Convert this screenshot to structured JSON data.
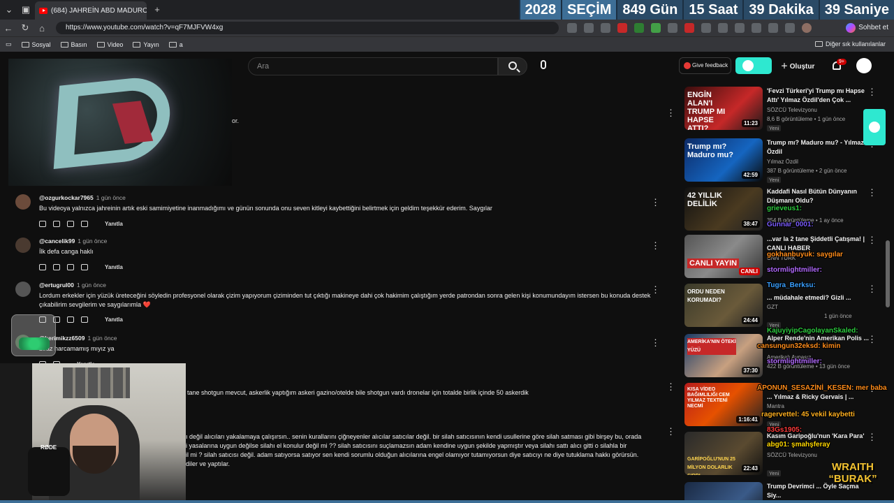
{
  "browser": {
    "tab_title": "(684) JAHREİN ABD MADURO OPE",
    "tab_close": "✕",
    "new_tab": "+",
    "url": "https://www.youtube.com/watch?v=qF7MJFVW4xg",
    "copilot_label": "Sohbet et",
    "bookmarks": [
      "Sosyal",
      "Basın",
      "Video",
      "Yayın",
      "a"
    ],
    "bookmarks_right": "Diğer sık kullanılanlar"
  },
  "countdown": {
    "year": "2028",
    "label": "SEÇİM",
    "days": "849 Gün",
    "hours": "15 Saat",
    "minutes": "39 Dakika",
    "seconds": "39 Saniye"
  },
  "youtube_header": {
    "search_placeholder": "Ara",
    "feedback_label": "Give feedback",
    "create_label": "Oluştur",
    "notif_count": "9+"
  },
  "video_stub_text": "or.",
  "comments": [
    {
      "user": "@ozgurkockar7965",
      "time": "1 gün önce",
      "text": "Bu videoya yalnızca jahreinin artık eski samimiyetine inanmadığımı ve günün sonunda onu seven kitleyi kaybettiğini belirtmek için geldim teşekkür ederim. Saygılar",
      "reply": "Yanıtla"
    },
    {
      "user": "@cancelik99",
      "time": "1 gün önce",
      "text": "İlk defa canga haklı",
      "reply": "Yanıtla"
    },
    {
      "user": "@ertugrul00",
      "time": "1 gün önce",
      "text": "Lordum erkekler için yüzük üreteceğini söyledin profesyonel olarak çizim yapıyorum çiziminden tut çıktığı makineye dahi çok hakimim çalıştığım yerde patrondan sonra gelen kişi konumundayım istersen bu konuda destek çıkabilirim sevgilerim ve saygılarımla ❤️",
      "reply": "Yanıtla"
    },
    {
      "user": "@kerimikzz6509",
      "time": "1 gün önce",
      "text": "biraz harcamamış mıyız ya",
      "reply": "Yanıtla"
    }
  ],
  "partial_lines": {
    "l1": "tane shotgun mevcut, askerlik yaptığım askeri gazino/otelde bile shotgun vardı dronelar için totalde birlik içinde 50 askerdik",
    "l2": "ı değil alıcıları yakalamaya çalışırsın.. senin kurallarını çiğneyenler alıcılar satıcılar değil. bir silah satıcısının kendi usullerine göre silah satması gibi birşey bu, orada",
    "l3": "i yasalarına uygun değilse silahı el konulur değil mi ?? silah satıcısını suçlamazsın adam kendine uygun şekilde yapmıştır veya silahı sattı alıcı gitti o silahla bir",
    "l4": "il mi ? silah satıcısı değil. adam satıyorsa satıyor sen kendi sorumlu olduğun alıcılarına engel olamıyor tutamıyorsun diye satıcıyı ne diye tutuklama hakkı görürsün.",
    "l5": "diler ve yaptılar."
  },
  "webcam_mic_label": "RØDE",
  "related": [
    {
      "thumb_text": "ENGİN ALAN'I TRUMP MI HAPSE ATTI?",
      "duration": "11:23",
      "title": "'Fevzi Türkeri'yi Trump mı Hapse Attı' Yılmaz Özdil'den Çok ...",
      "channel": "SÖZCÜ Televizyonu",
      "meta": "8,6 B görüntüleme • 1 gün önce",
      "new": "Yeni"
    },
    {
      "thumb_text": "Trump mı? Maduro mu?",
      "duration": "42:59",
      "title": "Trump mı? Maduro mu? - Yılmaz Özdil",
      "channel": "Yılmaz Özdil",
      "meta": "387 B görüntüleme • 2 gün önce",
      "new": "Yeni"
    },
    {
      "thumb_text": "42 YILLIK DELİLİK",
      "duration": "38:47",
      "title": "Kaddafi Nasıl Bütün Dünyanın Düşmanı Oldu?",
      "channel": "",
      "meta": "354 B görüntüleme • 1 ay önce",
      "new": ""
    },
    {
      "thumb_text": "CANLI YAYIN",
      "duration": "CANLI",
      "title": "...var la 2 tane Şiddetli Çatışma! | CANLI HABER",
      "channel": "CNN TÜRK",
      "meta": "",
      "new": ""
    },
    {
      "thumb_text": "ORDU NEDEN KORUMADI?",
      "duration": "24:44",
      "title": "... müdahale etmedi? Gizli ...",
      "channel": "GZT",
      "meta": "1 gün önce",
      "new": "Yeni"
    },
    {
      "thumb_text": "AMERİKA'NIN ÖTEKİ YÜZÜ",
      "duration": "37:30",
      "title": "Alper Rende'nin Amerikan Polis ...",
      "channel": "Amerikalı Avpaşız",
      "meta": "422 B görüntüleme • 13 gün önce",
      "new": ""
    },
    {
      "thumb_text": "KISA VİDEO BAĞIMLILIĞI CEM YILMAZ TEXTENİ NECMİ",
      "duration": "1:16:41",
      "title": "... Yılmaz & Ricky Gervais | ...",
      "channel": "Mantra",
      "meta": "",
      "new": "Yeni"
    },
    {
      "thumb_text": "GARİPOĞLU'NUN 25 MİLYON DOLARLIK SIRRI",
      "duration": "22:43",
      "title": "Kasım Garipoğlu'nun 'Kara Para' ...",
      "channel": "SÖZCÜ Televizyonu",
      "meta": "",
      "new": "Yeni"
    },
    {
      "thumb_text": "",
      "duration": "",
      "title": "Trump Devrimci ... Öyle Saçma Siy...",
      "channel": "",
      "meta": "",
      "new": ""
    }
  ],
  "chat_overlay": [
    {
      "text": "grieveus1:",
      "color": "#2ecc40"
    },
    {
      "text": "Gunnar_0001:",
      "color": "#7b5cff"
    },
    {
      "text": "gokhanbuyuk: saygılar",
      "color": "#ff8c1a"
    },
    {
      "text": "stormlightmiller:",
      "color": "#b36bff"
    },
    {
      "text": "Tugra_Berksu:",
      "color": "#3aa0ff"
    },
    {
      "text": "KajuyiyipCagolayanSkaled:",
      "color": "#2ecc40"
    },
    {
      "text": "cansungun32eksd: kimin",
      "color": "#ff8c1a"
    },
    {
      "text": "stormlightmiller:",
      "color": "#b36bff"
    },
    {
      "text": "APONUN_SESAZİNİ_KESEN: mer baba",
      "color": "#ff8c1a"
    },
    {
      "text": "ragervettel: 45 vekil kaybetti",
      "color": "#ffb020"
    },
    {
      "text": "83Gs1905:",
      "color": "#ff3a3a"
    },
    {
      "text": "abg01: şmahşferay",
      "color": "#ffd700"
    }
  ],
  "brand": {
    "line1": "WRAITH",
    "line2": "“BURAK”"
  }
}
